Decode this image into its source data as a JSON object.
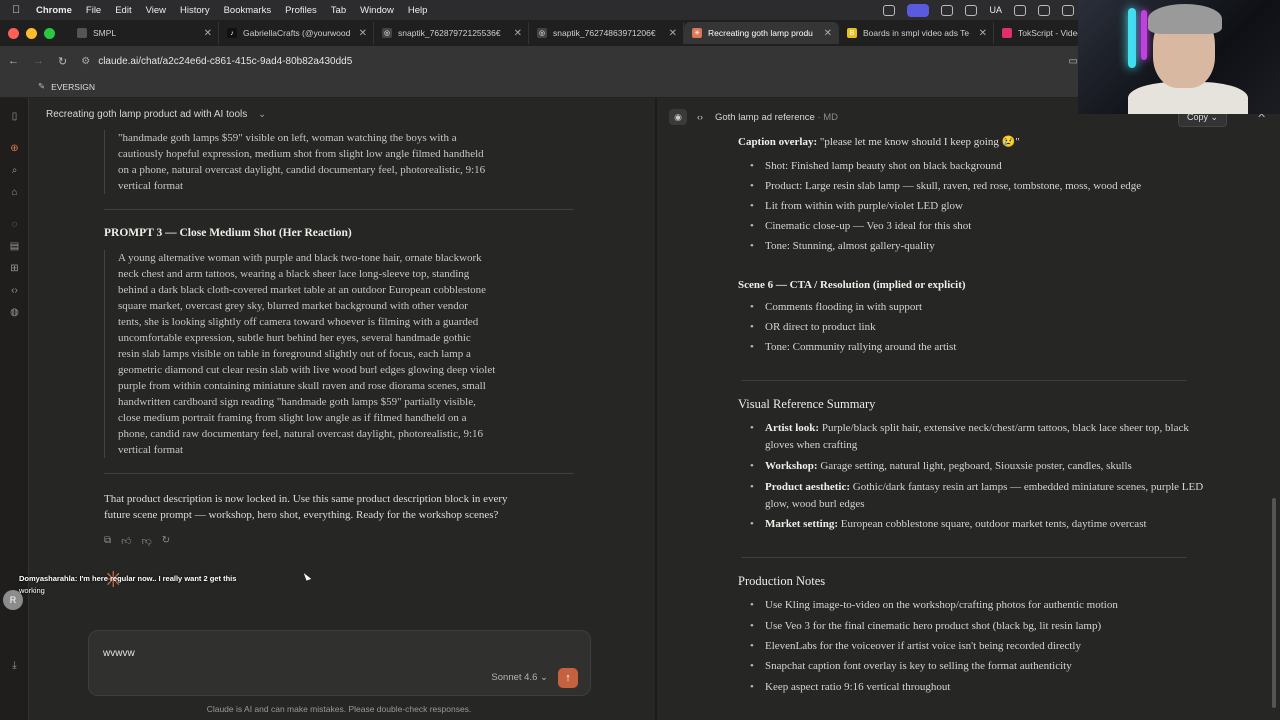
{
  "menubar": {
    "app": "Chrome",
    "items": [
      "File",
      "Edit",
      "View",
      "History",
      "Bookmarks",
      "Profiles",
      "Tab",
      "Window",
      "Help"
    ],
    "status": "UA"
  },
  "tabs": [
    {
      "label": "SMPL",
      "fav_color": "#555555"
    },
    {
      "label": "GabriellaCrafts (@yourwood",
      "fav_color": "#111111"
    },
    {
      "label": "snaptik_76287972125536€",
      "fav_color": "#444444"
    },
    {
      "label": "snaptik_76274863971206€",
      "fav_color": "#444444"
    },
    {
      "label": "Recreating goth lamp produ",
      "fav_color": "#d97757",
      "active": true
    },
    {
      "label": "Boards in smpl video ads Te",
      "fav_color": "#e8c020"
    },
    {
      "label": "TokScript - Video",
      "fav_color": "#e0306a"
    }
  ],
  "address": {
    "url": "claude.ai/chat/a2c24e6d-c861-415c-9ad4-80b82a430dd5"
  },
  "bookmarks": {
    "item": "EVERSIGN"
  },
  "chat": {
    "title": "Recreating goth lamp product ad with AI tools",
    "prev_quote_lines": [
      "\"handmade goth lamps $59\" visible on left, woman watching the boys with a",
      "cautiously hopeful expression, medium shot from slight low angle filmed handheld",
      "on a phone, natural overcast daylight, candid documentary feel, photorealistic, 9:16",
      "vertical format"
    ],
    "prompt3_heading": "PROMPT 3 — Close Medium Shot (Her Reaction)",
    "prompt3_lines": [
      "A young alternative woman with purple and black two-tone hair, ornate blackwork",
      "neck chest and arm tattoos, wearing a black sheer lace long-sleeve top, standing",
      "behind a dark black cloth-covered market table at an outdoor European cobblestone",
      "square market, overcast grey sky, blurred market background with other vendor",
      "tents, she is looking slightly off camera toward whoever is filming with a guarded",
      "uncomfortable expression, subtle hurt behind her eyes, several handmade gothic",
      "resin slab lamps visible on table in foreground slightly out of focus, each lamp a",
      "geometric diamond cut clear resin slab with live wood burl edges glowing deep violet",
      "purple from within containing miniature skull raven and rose diorama scenes, small",
      "handwritten cardboard sign reading \"handmade goth lamps $59\" partially visible,",
      "close medium portrait framing from slight low angle as if filmed handheld on a",
      "phone, candid raw documentary feel, natural overcast daylight, photorealistic, 9:16",
      "vertical format"
    ],
    "reply_lines": [
      "That product description is now locked in. Use this same product description block in every",
      "future scene prompt — workshop, hero shot, everything. Ready for the workshop scenes?"
    ],
    "composer_text": "wvwvw",
    "model": "Sonnet 4.6",
    "disclaimer": "Claude is AI and can make mistakes. Please double-check responses.",
    "overlay_caption_1": "Domyasharahla: I'm here regular now.. I really want 2 get this",
    "overlay_caption_2": "working",
    "avatar_letter": "R"
  },
  "panel": {
    "title": "Goth lamp ad reference",
    "format": "MD",
    "copy_label": "Copy",
    "caption_label": "Caption overlay:",
    "caption_value": "\"please let me know should I keep going 😢\"",
    "scene5_items": [
      "Shot: Finished lamp beauty shot on black background",
      "Product: Large resin slab lamp — skull, raven, red rose, tombstone, moss, wood edge",
      "Lit from within with purple/violet LED glow",
      "Cinematic close-up — Veo 3 ideal for this shot",
      "Tone: Stunning, almost gallery-quality"
    ],
    "scene6_heading": "Scene 6 — CTA / Resolution (implied or explicit)",
    "scene6_items": [
      "Comments flooding in with support",
      "OR direct to product link",
      "Tone: Community rallying around the artist"
    ],
    "visual_heading": "Visual Reference Summary",
    "visual_items": [
      {
        "label": "Artist look:",
        "text": "Purple/black split hair, extensive neck/chest/arm tattoos, black lace sheer",
        "text2": "top, black gloves when crafting"
      },
      {
        "label": "Workshop:",
        "text": "Garage setting, natural light, pegboard, Siouxsie poster, candles, skulls",
        "text2": ""
      },
      {
        "label": "Product aesthetic:",
        "text": "Gothic/dark fantasy resin art lamps — embedded miniature scenes,",
        "text2": "purple LED glow, wood burl edges"
      },
      {
        "label": "Market setting:",
        "text": "European cobblestone square, outdoor market tents, daytime overcast",
        "text2": ""
      }
    ],
    "production_heading": "Production Notes",
    "production_items": [
      "Use Kling image-to-video on the workshop/crafting photos for authentic motion",
      "Use Veo 3 for the final cinematic hero product shot (black bg, lit resin lamp)",
      "ElevenLabs for the voiceover if artist voice isn't being recorded directly",
      "Snapchat caption font overlay is key to selling the format authenticity",
      "Keep aspect ratio 9:16 vertical throughout"
    ]
  }
}
